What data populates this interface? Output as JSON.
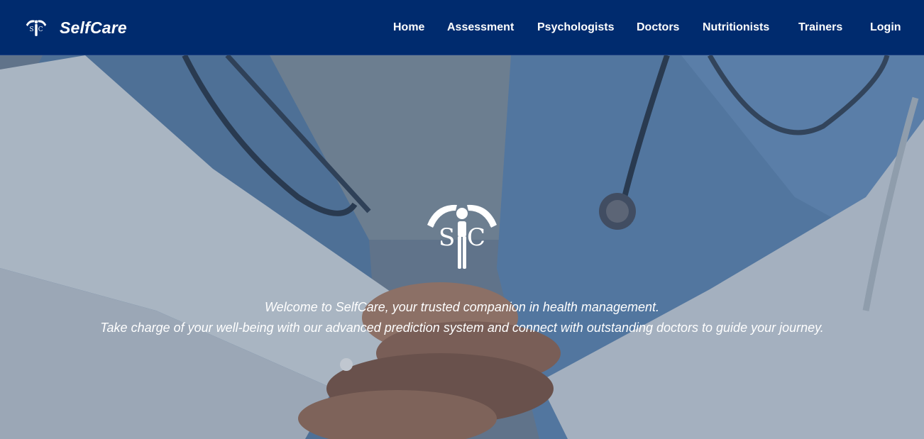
{
  "brand": {
    "name": "SelfCare",
    "logo_icon": "selfcare-logo-icon"
  },
  "nav": {
    "items": [
      {
        "label": "Home"
      },
      {
        "label": "Assessment"
      },
      {
        "label": "Psychologists"
      },
      {
        "label": "Doctors"
      },
      {
        "label": "Nutritionists"
      },
      {
        "label": "Trainers"
      },
      {
        "label": "Login"
      }
    ]
  },
  "hero": {
    "logo_icon": "selfcare-emblem-icon",
    "background": "medical-team-hands-together-photo",
    "line1": "Welcome to SelfCare, your trusted companion in health management.",
    "line2": "Take charge of your well-being with our advanced prediction system and connect with outstanding doctors to guide your journey."
  },
  "colors": {
    "navbar": "#002b6e",
    "text": "#ffffff"
  }
}
